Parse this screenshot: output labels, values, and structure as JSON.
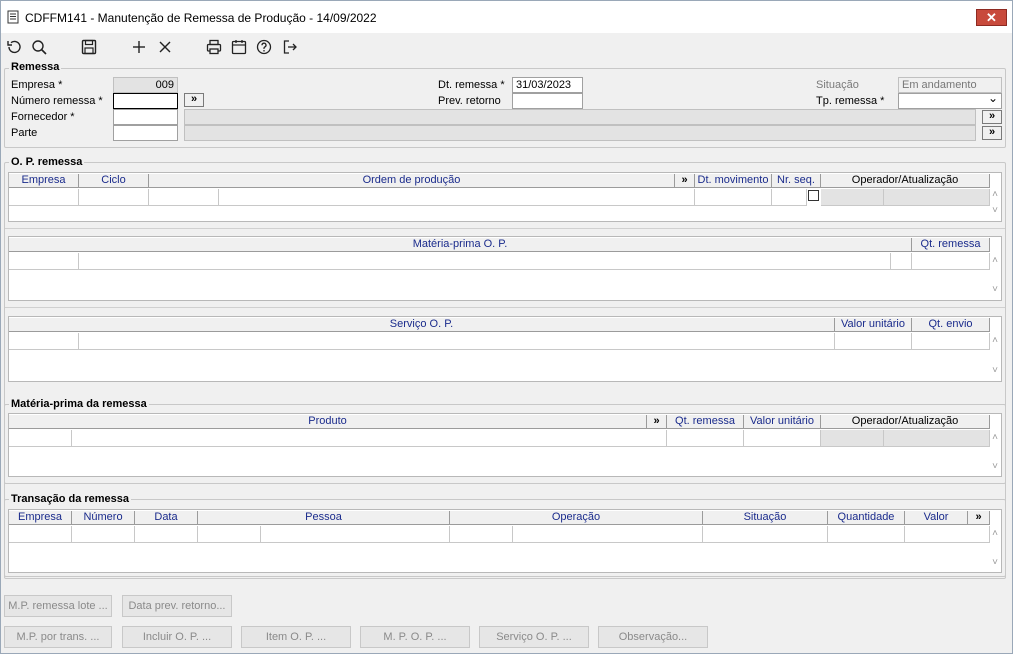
{
  "window": {
    "title": "CDFFM141 - Manutenção de Remessa de Produção - 14/09/2022",
    "close_label": "✕"
  },
  "toolbar": {
    "icons": [
      "undo-icon",
      "search-icon",
      "save-icon",
      "add-icon",
      "delete-icon",
      "print-icon",
      "calendar-icon",
      "help-icon",
      "exit-icon"
    ]
  },
  "remessa": {
    "title": "Remessa",
    "empresa_label": "Empresa *",
    "empresa_value": "009",
    "numero_label": "Número remessa *",
    "numero_value": "",
    "fornecedor_label": "Fornecedor *",
    "parte_label": "Parte",
    "dt_remessa_label": "Dt. remessa *",
    "dt_remessa_value": "31/03/2023",
    "prev_retorno_label": "Prev. retorno",
    "prev_retorno_value": "",
    "situacao_label": "Situação",
    "situacao_value": "Em andamento",
    "tp_remessa_label": "Tp. remessa *",
    "tp_remessa_value": ""
  },
  "op_remessa": {
    "title": "O. P. remessa",
    "columns": {
      "empresa": "Empresa",
      "ciclo": "Ciclo",
      "ordem": "Ordem de produção",
      "arrow": "»",
      "dt_movimento": "Dt. movimento",
      "nr_seq": "Nr. seq.",
      "operador": "Operador/Atualização"
    }
  },
  "mp_op": {
    "columns": {
      "materia": "Matéria-prima O. P.",
      "qt_remessa": "Qt. remessa"
    }
  },
  "servico_op": {
    "columns": {
      "servico": "Serviço O. P.",
      "valor_unitario": "Valor unitário",
      "qt_envio": "Qt. envio"
    }
  },
  "mp_remessa": {
    "title": "Matéria-prima da remessa",
    "columns": {
      "produto": "Produto",
      "arrow": "»",
      "qt_remessa": "Qt. remessa",
      "valor_unitario": "Valor unitário",
      "operador": "Operador/Atualização"
    }
  },
  "transacao": {
    "title": "Transação da remessa",
    "columns": {
      "empresa": "Empresa",
      "numero": "Número",
      "data": "Data",
      "pessoa": "Pessoa",
      "operacao": "Operação",
      "situacao": "Situação",
      "quantidade": "Quantidade",
      "valor": "Valor",
      "arrow": "»"
    }
  },
  "buttons": {
    "mp_remessa_lote": "M.P. remessa lote ...",
    "data_prev_retorno": "Data prev. retorno...",
    "mp_por_trans": "M.P. por trans. ...",
    "incluir_op": "Incluir O. P. ...",
    "item_op": "Item O. P. ...",
    "mpop": "M. P. O. P. ...",
    "servico_op": "Serviço O. P. ...",
    "observacao": "Observação..."
  },
  "lookup_glyph": "»",
  "scroll": {
    "up": "˄",
    "down": "˅"
  },
  "dropdown_glyph": "⌄"
}
